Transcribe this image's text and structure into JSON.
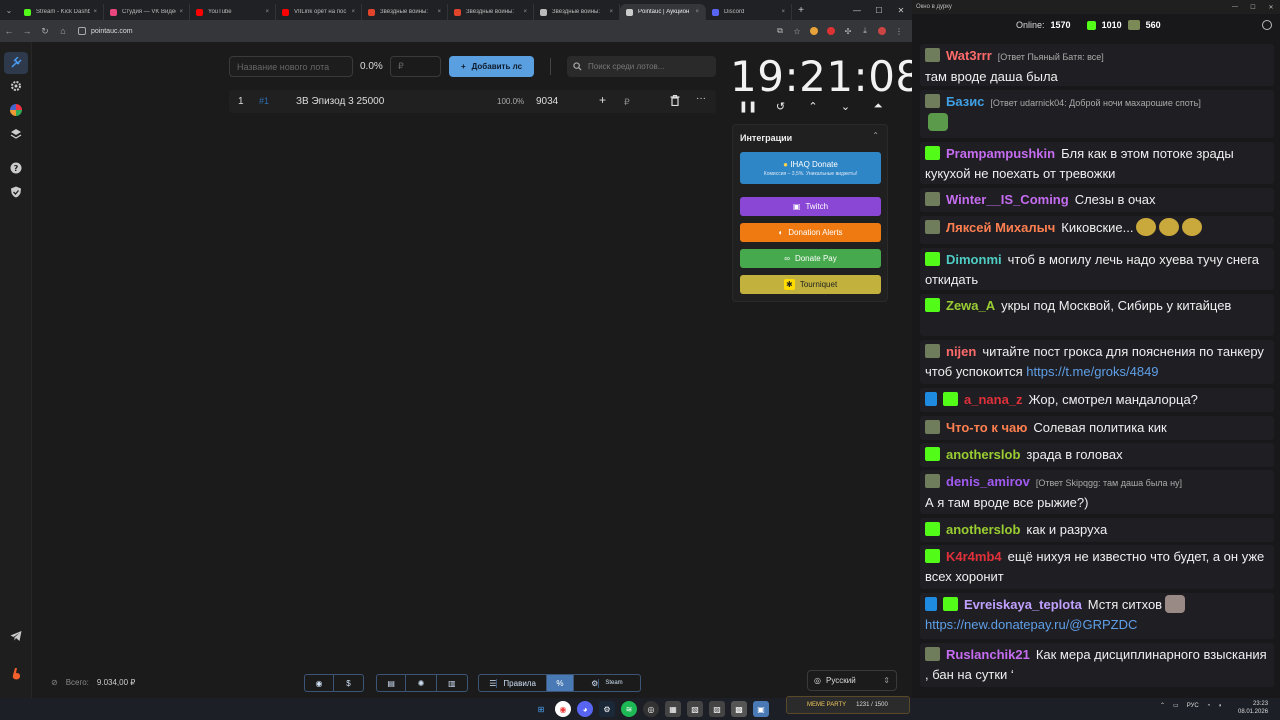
{
  "browser": {
    "tabs": [
      {
        "label": "Stream - Kick Dashbo",
        "color": "#53fc18"
      },
      {
        "label": "Студия — VK Видео",
        "color": "#e8467c"
      },
      {
        "label": "YouTube",
        "color": "#ff0000"
      },
      {
        "label": "VIILink орёт на пос",
        "color": "#ff0000"
      },
      {
        "label": "Звёздные войны:",
        "color": "#e0452b"
      },
      {
        "label": "Звёздные войны:",
        "color": "#e0452b"
      },
      {
        "label": "Звёздные войны:",
        "color": "#bbbbbb"
      },
      {
        "label": "Pointauc | Аукцион",
        "color": "#cccccc",
        "active": true
      },
      {
        "label": "Discord",
        "color": "#5865f2"
      }
    ],
    "url": "pointauc.com"
  },
  "auction": {
    "new_lot_placeholder": "Название нового лота",
    "percent": "0.0%",
    "amount_placeholder": "₽",
    "add_button": "Добавить лс",
    "search_placeholder": "Поиск среди лотов...",
    "lots": [
      {
        "index": "1",
        "id": "#1",
        "name": "ЗВ Эпизод 3 25000",
        "percent": "100.0%",
        "amount": "9034",
        "currency": "₽"
      }
    ],
    "timer": "19:21:08",
    "total_label": "Всего:",
    "total_value": "9.034,00 ₽",
    "language": "Русский"
  },
  "integrations": {
    "title": "Интеграции",
    "donate_title": "IHAQ Donate",
    "donate_sub": "Комиссия – 3,5%. Уникальные виджеты!",
    "twitch": "Twitch",
    "donation_alerts": "Donation Alerts",
    "donate_pay": "Donate Pay",
    "tourniquet": "Tourniquet"
  },
  "bottom_bar": {
    "rules": "Правила",
    "percent_btn": "%",
    "steam": "Steam"
  },
  "chat": {
    "window_title": "Окно в дурку",
    "online_label": "Online:",
    "online_value": "1570",
    "kick_count": "1010",
    "other_count": "560",
    "messages": [
      {
        "user": "Wat3rrr",
        "color": "#ff6b6b",
        "badge": "s",
        "reply": "[Ответ Пьяный Батя: все]",
        "text": "там вроде даша была"
      },
      {
        "user": "Базис",
        "color": "#3fa0e6",
        "badge": "s",
        "reply": "[Ответ udarnick04: Доброй ночи махарошие  споть]",
        "text": ""
      },
      {
        "user": "Prampampushkin",
        "color": "#c56cf0",
        "badge": "k",
        "text": "Бля как в этом потоке зрады кукухой не поехать от тревожки"
      },
      {
        "user": "Winter__IS_Coming",
        "color": "#c56cf0",
        "badge": "s",
        "text": "Слезы в очах"
      },
      {
        "user": "Ляксей Михалыч",
        "color": "#ff7f50",
        "badge": "s",
        "text": "Киковские..."
      },
      {
        "user": "Dimonmi",
        "color": "#4ecdc4",
        "badge": "k",
        "text": "чтоб в могилу лечь надо хуева тучу снега откидать"
      },
      {
        "user": "Zewa_A",
        "color": "#9acd32",
        "badge": "k",
        "text": "укры под Москвой, Сибирь у китайцев"
      },
      {
        "user": "nijen",
        "color": "#ff6b6b",
        "badge": "s",
        "text": "читайте пост грокса для пояснения по танкеру чтоб успокоится",
        "link": "https://t.me/groks/4849"
      },
      {
        "user": "a_nana_z",
        "color": "#e0303a",
        "badge": "k",
        "text": "Жор, смотрел мандалорца?"
      },
      {
        "user": "Что-то к чаю",
        "color": "#ff7f50",
        "badge": "s",
        "text": "Солевая политика кик"
      },
      {
        "user": "anotherslob",
        "color": "#9acd32",
        "badge": "k",
        "text": "зрада в головах"
      },
      {
        "user": "denis_amirov",
        "color": "#a05af0",
        "badge": "s",
        "reply": "[Ответ Skipqgg: там даша была ну]",
        "text": "А я там вроде все рыжие?)"
      },
      {
        "user": "anotherslob",
        "color": "#9acd32",
        "badge": "k",
        "text": "как и разруха"
      },
      {
        "user": "K4r4mb4",
        "color": "#e0303a",
        "badge": "k",
        "text": "ещё нихуя не известно что будет, а он уже всех хоронит"
      },
      {
        "user": "Evreiskaya_teplota",
        "color": "#c0a0ff",
        "badge": "k",
        "text": "Мстя ситхов",
        "link": "https://new.donatepay.ru/@GRPZDC"
      },
      {
        "user": "Ruslanchik21",
        "color": "#c56cf0",
        "badge": "s",
        "text": "Как мера дисциплинарного взыскания , бан на сутки ‘"
      }
    ]
  },
  "taskbar": {
    "meme_label": "MEME PARTY",
    "meme_count": "1231 / 1500",
    "lang": "РУС",
    "time": "23:23",
    "date": "08.01.2026"
  }
}
